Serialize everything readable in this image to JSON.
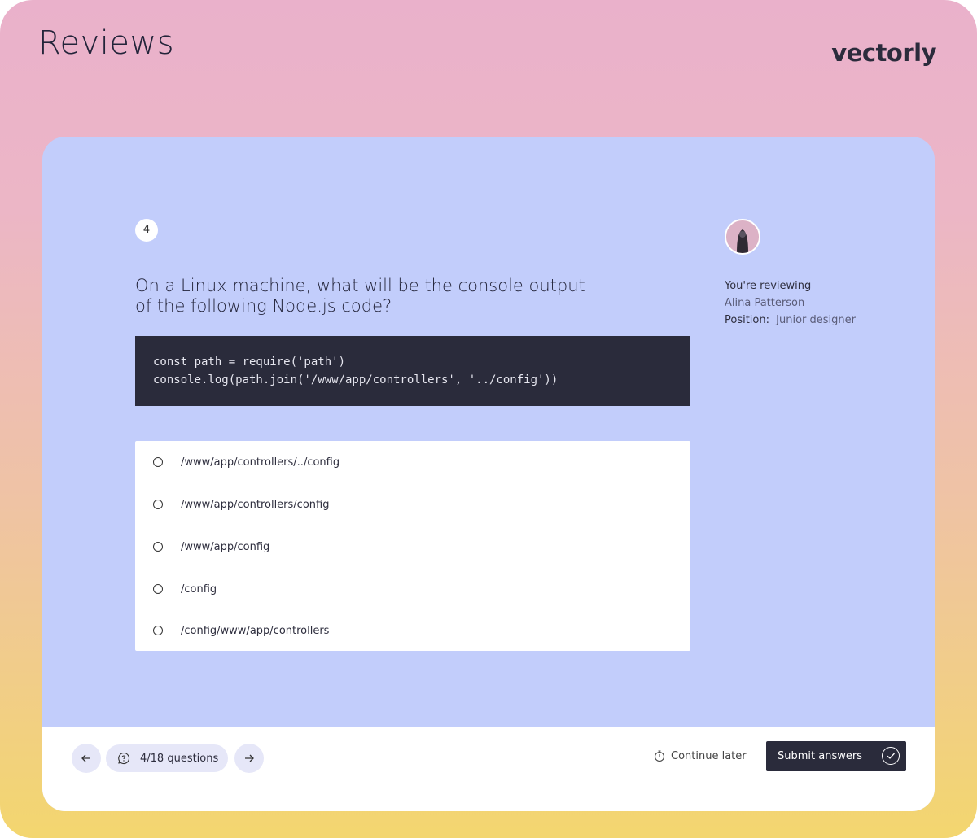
{
  "header": {
    "title": "Reviews",
    "brand": "vectorly"
  },
  "question": {
    "number": "4",
    "text_line1": "On a Linux machine, what will be the console output",
    "text_line2": "of the following Node.js code?",
    "code_lines": [
      "const path = require('path')",
      "console.log(path.join('/www/app/controllers', '../config'))"
    ],
    "options": [
      "/www/app/controllers/../config",
      "/www/app/controllers/config",
      "/www/app/config",
      "/config",
      "/config/www/app/controllers"
    ]
  },
  "reviewer": {
    "label": "You're reviewing",
    "name": "Alina Patterson",
    "position_label": "Position:",
    "position_value": "Junior designer"
  },
  "footer": {
    "progress": "4/18 questions",
    "continue_label": "Continue later",
    "submit_label": "Submit answers"
  },
  "icons": {
    "prev": "arrow-left-icon",
    "next": "arrow-right-icon",
    "questions": "question-bubble-icon",
    "timer": "timer-icon",
    "check": "check-icon"
  },
  "colors": {
    "card_bg": "#c2cdfb",
    "dark": "#2a2b3b",
    "pill_bg": "#e6e7f8"
  }
}
